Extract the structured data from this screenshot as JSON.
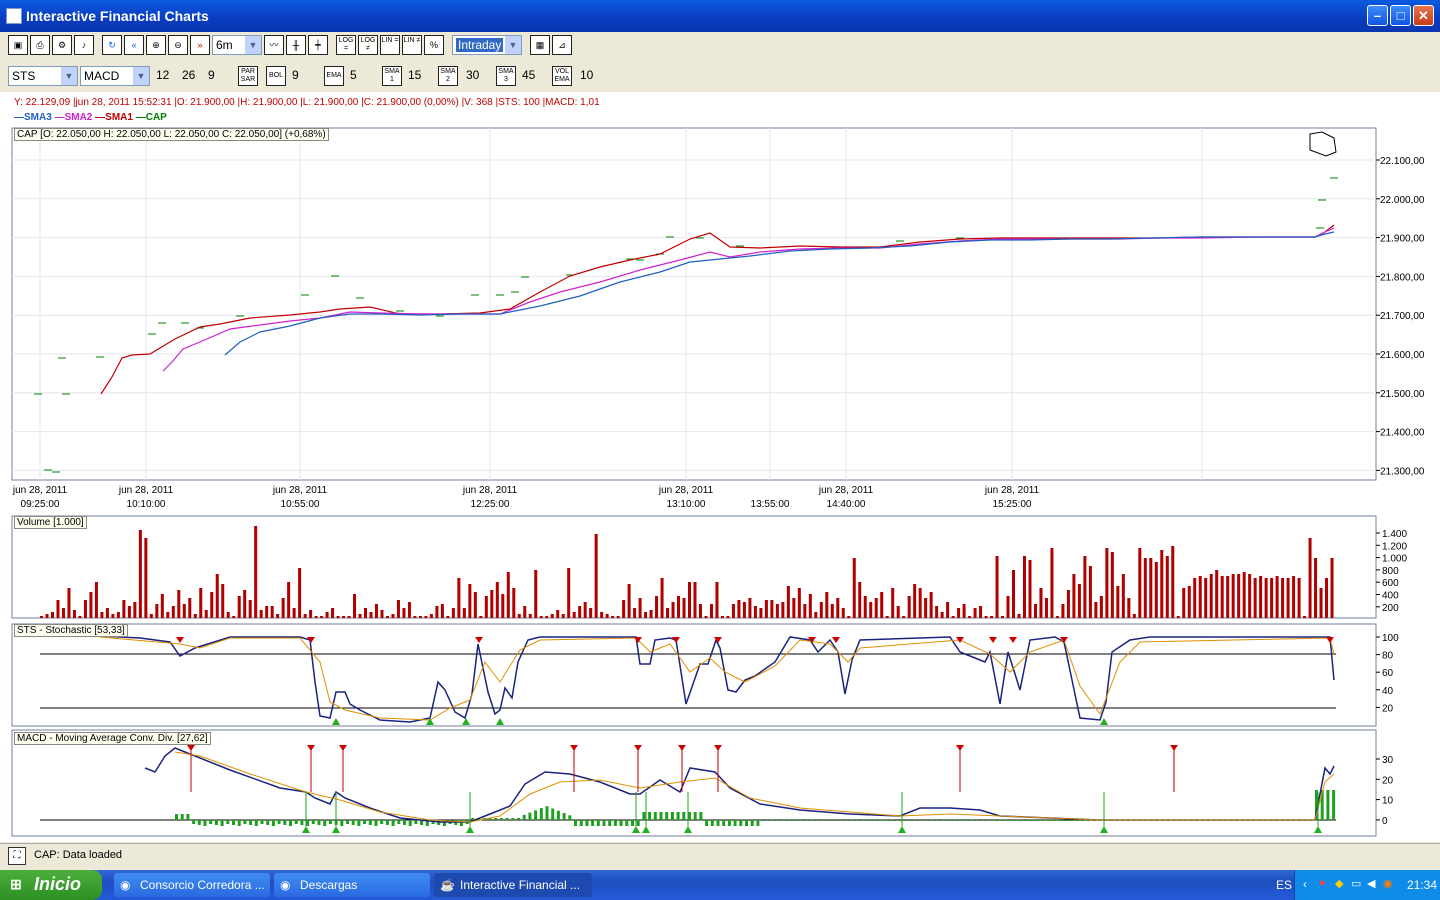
{
  "window": {
    "title": "Interactive Financial Charts"
  },
  "toolbar": {
    "period": "6m",
    "interval": "Intraday",
    "buttons": [
      "save",
      "print",
      "settings",
      "sound",
      "refresh",
      "back",
      "zoom-in",
      "zoom-out",
      "forward"
    ],
    "scale_buttons": [
      "LOG =",
      "LOG ≠",
      "LIN =",
      "LIN ≠",
      "%"
    ]
  },
  "toolbar2": {
    "symbol": "STS",
    "indicator": "MACD",
    "macd_params": [
      "12",
      "26",
      "9"
    ],
    "par_sar": "PAR SAR",
    "bol": "BOL",
    "bol_value": "9",
    "ema": "EMA",
    "ema_value": "5",
    "sma1": "SMA 1",
    "sma1_value": "15",
    "sma2": "SMA 2",
    "sma2_value": "30",
    "sma3": "SMA 3",
    "sma3_value": "45",
    "vol_ema": "VOL EMA",
    "vol_ema_value": "10"
  },
  "info_line": "Y: 22.129,09 |jun 28, 2011 15:52:31 |O: 21.900,00 |H: 21.900,00 |L: 21.900,00 |C: 21.900,00 (0,00%) |V: 368 |STS: 100 |MACD: 1,01",
  "legend": [
    {
      "label": "SMA3",
      "color": "#2060c0"
    },
    {
      "label": "SMA2",
      "color": "#d020d0"
    },
    {
      "label": "SMA1",
      "color": "#c00000"
    },
    {
      "label": "CAP",
      "color": "#008000"
    }
  ],
  "cap_label": "CAP [O: 22.050,00  H: 22.050,00  L: 22.050,00  C: 22.050,00] (+0,68%)",
  "price_axis": [
    "22.100,00",
    "22.000,00",
    "21.900,00",
    "21.800,00",
    "21.700,00",
    "21.600,00",
    "21.500,00",
    "21.400,00",
    "21.300,00"
  ],
  "time_axis": [
    {
      "date": "jun 28, 2011",
      "time": "09:25:00"
    },
    {
      "date": "jun 28, 2011",
      "time": "10:10:00"
    },
    {
      "date": "jun 28, 2011",
      "time": "10:55:00"
    },
    {
      "date": "jun 28, 2011",
      "time": "12:25:00"
    },
    {
      "date": "jun 28, 2011",
      "time": "13:10:00"
    },
    {
      "date": "",
      "time": "13:55:00"
    },
    {
      "date": "jun 28, 2011",
      "time": "14:40:00"
    },
    {
      "date": "jun 28, 2011",
      "time": "15:25:00"
    }
  ],
  "volume_panel": {
    "label": "Volume [1.000]",
    "axis": [
      "1.400",
      "1.200",
      "1.000",
      "800",
      "600",
      "400",
      "200"
    ]
  },
  "sts_panel": {
    "label": "STS - Stochastic [53,33]",
    "axis": [
      "100",
      "80",
      "60",
      "40",
      "20"
    ]
  },
  "macd_panel": {
    "label": "MACD - Moving Average Conv. Div. [27,62]",
    "axis": [
      "30",
      "20",
      "10",
      "0"
    ]
  },
  "status": "CAP: Data loaded",
  "taskbar": {
    "start": "Inicio",
    "tasks": [
      "Consorcio Corredora ...",
      "Descargas",
      "Interactive Financial ..."
    ],
    "lang": "ES",
    "clock": "21:34"
  }
}
